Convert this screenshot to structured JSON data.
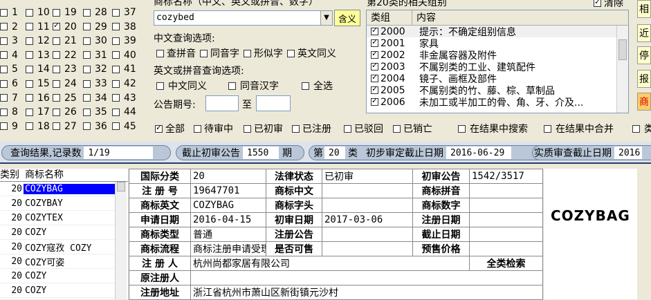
{
  "class_columns": [
    [
      "1",
      "2",
      "3",
      "4",
      "5",
      "6",
      "7",
      "8",
      "9"
    ],
    [
      "10",
      "11",
      "12",
      "13",
      "14",
      "15",
      "16",
      "17",
      "18"
    ],
    [
      "19",
      "20",
      "21",
      "22",
      "23",
      "24",
      "25",
      "26",
      "27"
    ],
    [
      "28",
      "29",
      "30",
      "31",
      "32",
      "33",
      "34",
      "35",
      "36"
    ],
    [
      "37",
      "38",
      "39",
      "40",
      "41",
      "42",
      "43",
      "44",
      "45"
    ]
  ],
  "class_checked": "20",
  "name_label": "商标名称（中文、英文或拼音、数字）",
  "name_value": "cozybed",
  "hanyi_button": "含义",
  "cn_options_label": "中文查询选项:",
  "cn_options": [
    "查拼音",
    "同音字",
    "形似字",
    "英文同义"
  ],
  "en_options_label": "英文或拼音查询选项:",
  "en_options": [
    "中文同义",
    "同音汉字",
    "全选"
  ],
  "issue_label": "公告期号:",
  "issue_to": "至",
  "groups_title": "第20类的相关组别",
  "clear_label": "清除",
  "groups_header": [
    "类组",
    "内容"
  ],
  "groups": [
    {
      "code": "2000",
      "text": "提示：不确定组别信息"
    },
    {
      "code": "2001",
      "text": "家具"
    },
    {
      "code": "2002",
      "text": "非金属容器及附件"
    },
    {
      "code": "2003",
      "text": "不属别类的工业、建筑配件"
    },
    {
      "code": "2004",
      "text": "镜子、画框及部件"
    },
    {
      "code": "2005",
      "text": "不属别类的竹、藤、棕、草制品"
    },
    {
      "code": "2006",
      "text": "未加工或半加工的骨、角、牙、介及..."
    }
  ],
  "status_filters": [
    "全部",
    "待审中",
    "已初审",
    "已注册",
    "已驳回",
    "已销亡"
  ],
  "result_options": [
    "在结果中搜索",
    "在结果中合并",
    "类"
  ],
  "side_buttons": [
    "相",
    "近",
    "停",
    "报",
    "商"
  ],
  "bar": {
    "result_label": "查询结果,记录数",
    "result_value": "1/19",
    "deadline_label": "截止初审公告",
    "deadline_value": "1550",
    "deadline_suffix": "期",
    "class_prefix": "第",
    "class_value": "20",
    "class_suffix": "类",
    "prelim_label": "初步审定截止日期",
    "prelim_value": "2016-06-29",
    "actual_label": "实质审查截止日期",
    "actual_value": "2016"
  },
  "list_header": [
    "类别",
    "商标名称"
  ],
  "trademarks": [
    {
      "cls": "20",
      "name": "COZYBAG"
    },
    {
      "cls": "20",
      "name": "COZYBAY"
    },
    {
      "cls": "20",
      "name": "COZYTEX"
    },
    {
      "cls": "20",
      "name": "COZY"
    },
    {
      "cls": "20",
      "name": "COZY寇孜 COZY"
    },
    {
      "cls": "20",
      "name": "COZY可姿"
    },
    {
      "cls": "20",
      "name": "COZY"
    },
    {
      "cls": "20",
      "name": "COZY"
    }
  ],
  "details": {
    "intl_class_k": "国际分类",
    "intl_class_v": "20",
    "legal_status_k": "法律状态",
    "legal_status_v": "已初审",
    "prelim_notice_k": "初审公告",
    "prelim_notice_v": "1542/3517",
    "reg_no_k": "注 册 号",
    "reg_no_v": "19647701",
    "cn_name_k": "商标中文",
    "cn_name_v": "",
    "pinyin_k": "商标拼音",
    "pinyin_v": "",
    "en_name_k": "商标英文",
    "en_name_v": "COZYBAG",
    "head_k": "商标字头",
    "head_v": "",
    "digit_k": "商标数字",
    "digit_v": "",
    "apply_date_k": "申请日期",
    "apply_date_v": "2016-04-15",
    "prelim_date_k": "初审日期",
    "prelim_date_v": "2017-03-06",
    "reg_date_k": "注册日期",
    "reg_date_v": "",
    "type_k": "商标类型",
    "type_v": "普通",
    "reg_notice_k": "注册公告",
    "reg_notice_v": "",
    "end_date_k": "截止日期",
    "end_date_v": "",
    "flow_k": "商标流程",
    "flow_v": "商标注册申请受理通知书",
    "sellable_k": "是否可售",
    "sellable_v": "",
    "presale_k": "预售价格",
    "presale_v": "",
    "registrant_k": "注 册 人",
    "registrant_v": "杭州尚都家居有限公司",
    "all_search": "全类检索",
    "orig_registrant_k": "原注册人",
    "orig_registrant_v": "",
    "address_k": "注册地址",
    "address_v": "浙江省杭州市萧山区新街镇元沙村"
  },
  "brand_preview": "COZYBAG"
}
